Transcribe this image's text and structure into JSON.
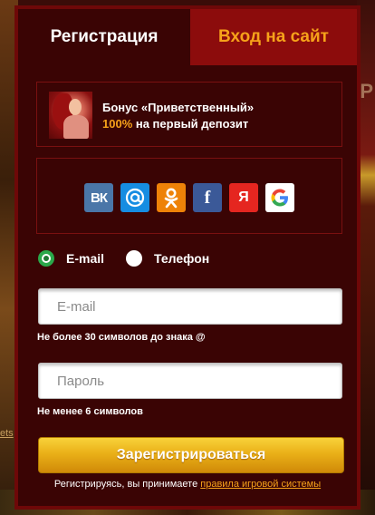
{
  "tabs": {
    "register_label": "Регистрация",
    "login_label": "Вход на сайт"
  },
  "bonus": {
    "line1": "Бонус «Приветственный»",
    "percent": "100%",
    "line2_rest": " на первый депозит"
  },
  "social": {
    "vk": "ВК",
    "mail": "@",
    "ok": "ОК",
    "fb": "f",
    "ya": "Я",
    "google": "G",
    "icons": [
      "vk-icon",
      "mail-ru-icon",
      "odnoklassniki-icon",
      "facebook-icon",
      "yandex-icon",
      "google-icon"
    ]
  },
  "method": {
    "email_label": "E-mail",
    "phone_label": "Телефон",
    "selected": "E-mail"
  },
  "form": {
    "email_placeholder": "E-mail",
    "email_hint": "Не более 30 символов до знака @",
    "password_placeholder": "Пароль",
    "password_hint": "Не менее 6 символов",
    "submit_label": "Зарегистрироваться"
  },
  "terms": {
    "prefix": "Регистрируясь, вы принимаете ",
    "link": "правила игровой системы"
  },
  "background": {
    "side_letter": "Р",
    "side_link": "ets"
  },
  "colors": {
    "modal_bg": "#3a0404",
    "tab_inactive_bg": "#8c0c0c",
    "accent": "#f6a21a",
    "radio_selected": "#2aa84a",
    "submit_gradient_top": "#f8d23a",
    "submit_gradient_bottom": "#d08a08"
  }
}
